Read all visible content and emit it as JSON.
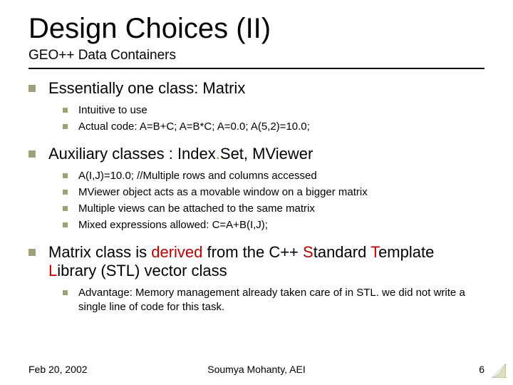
{
  "title": "Design Choices (II)",
  "subtitle": "GEO++ Data Containers",
  "bullets": {
    "b1": {
      "label": "Essentially one class: Matrix",
      "sub1": "Intuitive to use",
      "sub2": "Actual code: A=B+C; A=B*C; A=0.0; A(5,2)=10.0;"
    },
    "b2": {
      "label_pre": "Auxiliary classes : Index",
      "label_dot": ".",
      "label_post": "Set, MViewer",
      "sub1": "A(I,J)=10.0; //Multiple rows and columns accessed",
      "sub2": "MViewer object acts as a movable window on a bigger matrix",
      "sub3": "Multiple views can be attached to the same matrix",
      "sub4": "Mixed expressions allowed: C=A+B(I,J);"
    },
    "b3": {
      "p1": "Matrix class is ",
      "p2": "derived",
      "p3": " from the C++ ",
      "p4": "S",
      "p5": "tandard ",
      "p6": "T",
      "p7": "emplate ",
      "p8": "L",
      "p9": "ibrary (STL) vector class",
      "sub1": "Advantage: Memory management already taken care of in STL. we did not write a single line of code for this task."
    }
  },
  "footer": {
    "date": "Feb 20, 2002",
    "author": "Soumya Mohanty, AEI",
    "page": "6"
  }
}
